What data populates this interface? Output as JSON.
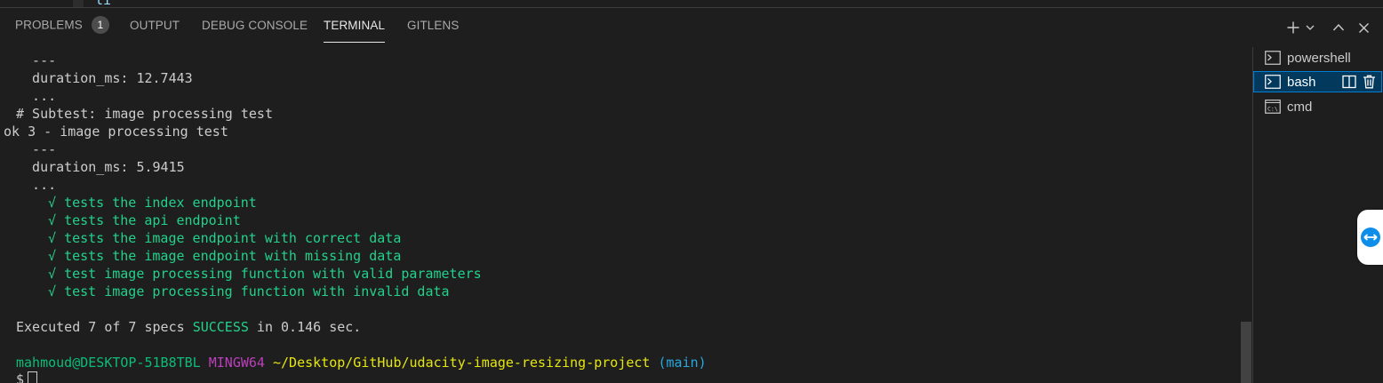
{
  "editor_fragment": "\"li     \"  \"",
  "panel": {
    "tabs": [
      {
        "label": "PROBLEMS",
        "badge": "1"
      },
      {
        "label": "OUTPUT"
      },
      {
        "label": "DEBUG CONSOLE"
      },
      {
        "label": "TERMINAL"
      },
      {
        "label": "GITLENS"
      }
    ],
    "active_tab": "TERMINAL"
  },
  "terminal": {
    "lines": [
      "  ---",
      "  duration_ms: 12.7443",
      "  ...",
      "# Subtest: image processing test",
      "ok 3 - image processing test",
      "  ---",
      "  duration_ms: 5.9415",
      "  ..."
    ],
    "specs": [
      "tests the index endpoint",
      "tests the api endpoint",
      "tests the image endpoint with correct data",
      "tests the image endpoint with missing data",
      "test image processing function with valid parameters",
      "test image processing function with invalid data"
    ],
    "check_mark": "√",
    "summary": {
      "prefix": "Executed 7 of 7 specs ",
      "status": "SUCCESS",
      "suffix": " in 0.146 sec."
    },
    "prompt": {
      "user_host": "mahmoud@DESKTOP-51B8TBL",
      "shell": "MINGW64",
      "path": "~/Desktop/GitHub/udacity-image-resizing-project",
      "branch": "(main)",
      "symbol": "$"
    }
  },
  "terminal_list": [
    {
      "label": "powershell",
      "icon": "terminal-icon"
    },
    {
      "label": "bash",
      "icon": "terminal-icon",
      "selected": true
    },
    {
      "label": "cmd",
      "icon": "cmd-icon"
    }
  ],
  "colors": {
    "background": "#1e1e1e",
    "green": "#23d18b",
    "magenta": "#bc3fbc",
    "yellow": "#e5e510",
    "blue": "#2aa7dd",
    "selection": "#04395e"
  }
}
